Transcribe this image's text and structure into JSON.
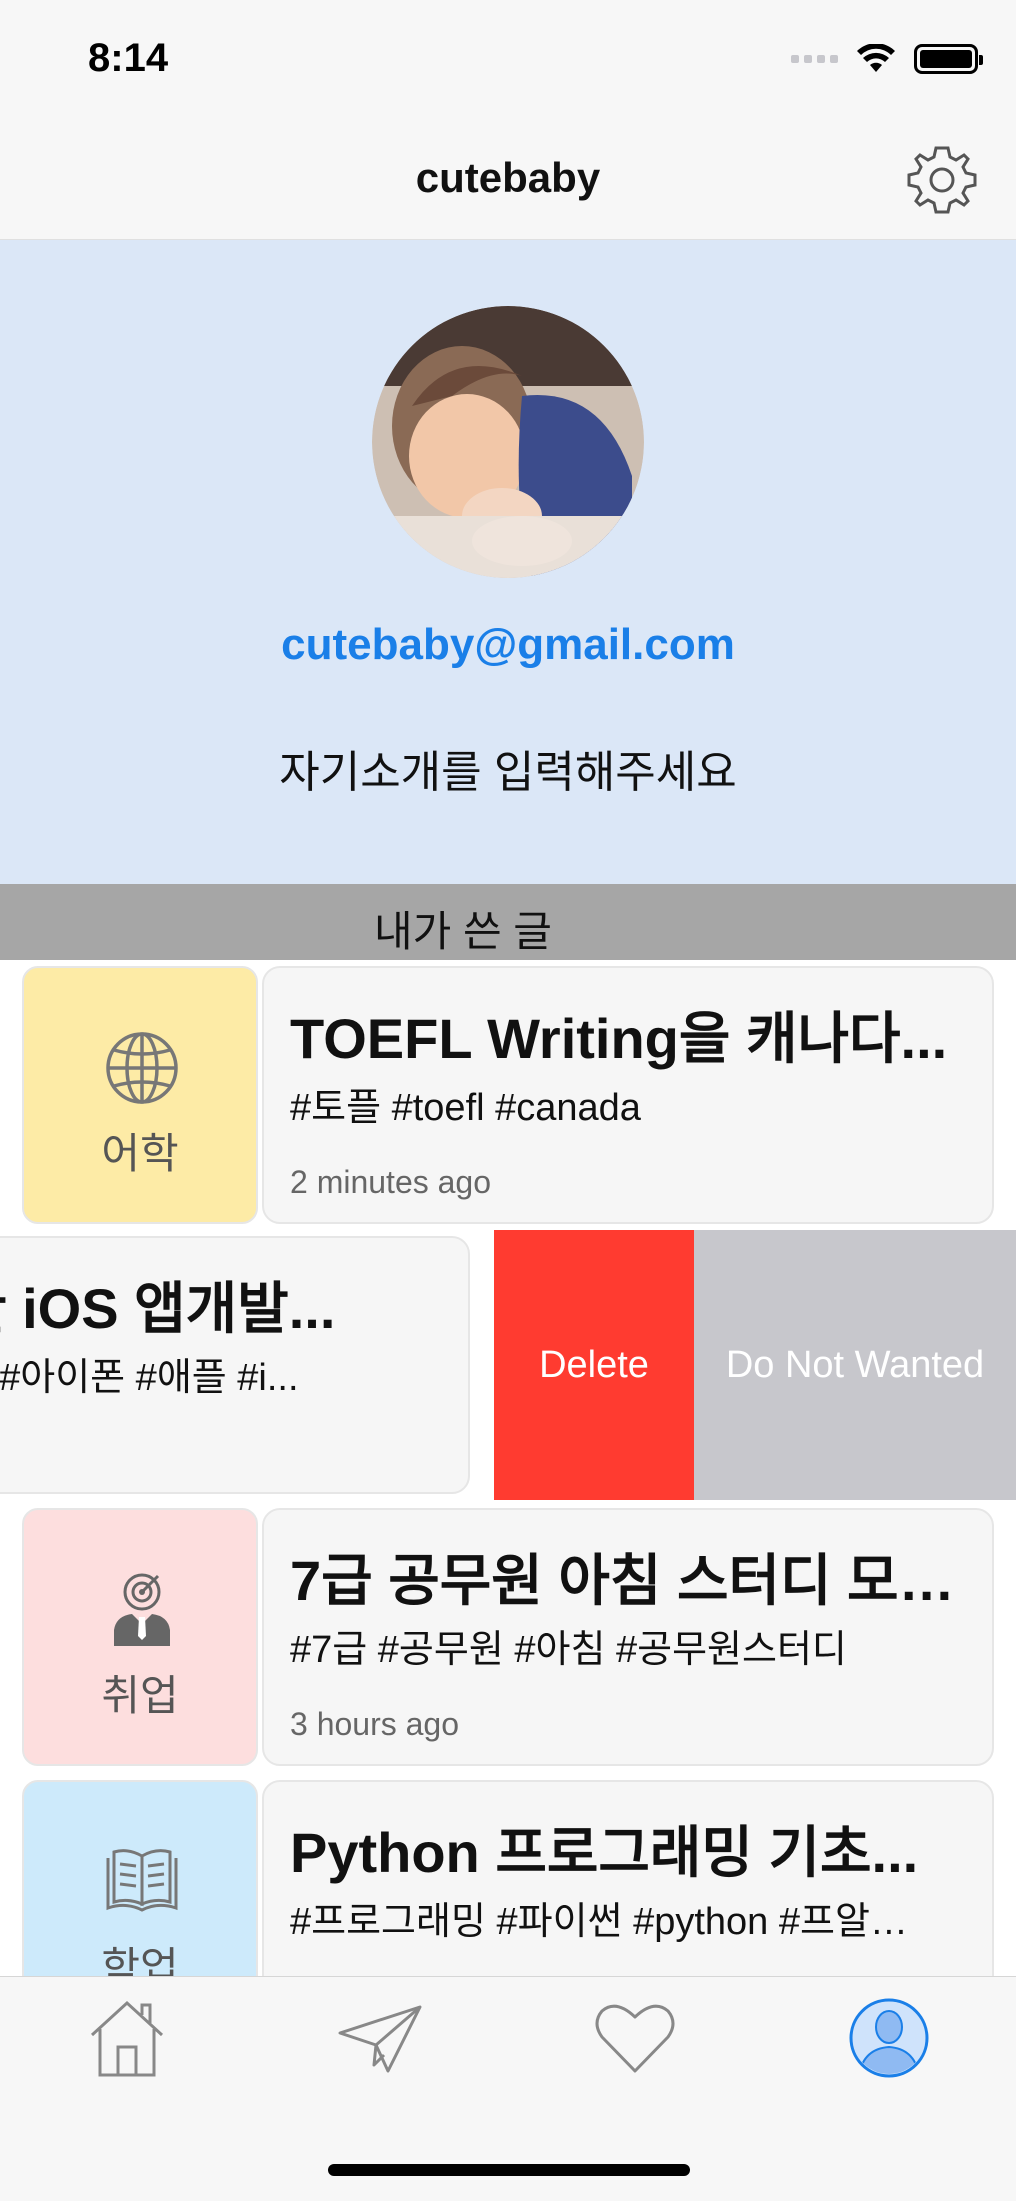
{
  "status_bar": {
    "time": "8:14"
  },
  "nav": {
    "title": "cutebaby"
  },
  "profile": {
    "email": "cutebaby@gmail.com",
    "intro": "자기소개를 입력해주세요"
  },
  "section": {
    "title": "내가 쓴 글"
  },
  "posts": [
    {
      "category": "어학",
      "category_color": "#fdeba6",
      "icon": "globe-icon",
      "title": "TOEFL Writing을 캐나다...",
      "tags": "#토플 #toefl #canada",
      "time": "2 minutes ago"
    },
    {
      "title": "활용한 iOS 앱개발...",
      "tags": "...프알못 #아이폰 #애플 #i...",
      "actions": {
        "delete": "Delete",
        "not_wanted": "Do Not Wanted"
      }
    },
    {
      "category": "취업",
      "category_color": "#fddede",
      "icon": "job-target-icon",
      "title": "7급 공무원 아침 스터디 모…",
      "tags": "#7급 #공무원 #아침 #공무원스터디",
      "time": "3 hours ago"
    },
    {
      "category": "학업",
      "category_color": "#cdeafb",
      "icon": "book-icon",
      "title": "Python 프로그래밍 기초...",
      "tags": "#프로그래밍 #파이썬 #python #프알…"
    }
  ],
  "tab_bar": {
    "items": [
      "home-icon",
      "paper-plane-icon",
      "heart-icon",
      "profile-icon"
    ],
    "active": "profile-icon",
    "active_color": "#1a7fe8"
  }
}
